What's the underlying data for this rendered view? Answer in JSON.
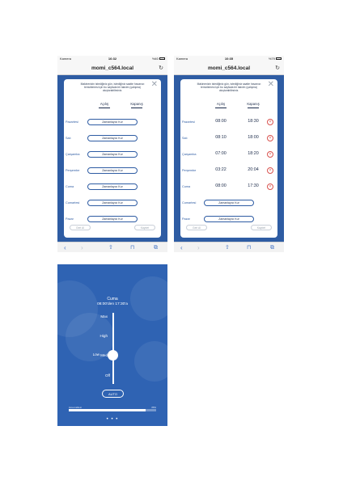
{
  "phones": [
    {
      "status": {
        "left": "Kamera",
        "time": "16:32",
        "right": "%40"
      },
      "url": "momi_c564.local",
      "instruction": "Makinenizin istediğiniz gün, istediğiniz saatte havanızı temizlemesi için bu sayfada bir takvim (çalışma) oluşturabilirsiniz.",
      "col_open": "Açılış",
      "col_close": "Kapanış",
      "days": [
        {
          "label": "Pazartesi",
          "button": "Zamanlayıcı Kur"
        },
        {
          "label": "Salı",
          "button": "Zamanlayıcı Kur"
        },
        {
          "label": "Çarşamba",
          "button": "Zamanlayıcı Kur"
        },
        {
          "label": "Perşembe",
          "button": "Zamanlayıcı Kur"
        },
        {
          "label": "Cuma",
          "button": "Zamanlayıcı Kur"
        },
        {
          "label": "Cumartesi",
          "button": "Zamanlayıcı Kur"
        },
        {
          "label": "Pazar",
          "button": "Zamanlayıcı Kur"
        }
      ],
      "footer_left": "Geri Al",
      "footer_right": "Kaydet"
    },
    {
      "status": {
        "left": "Kamera",
        "time": "10:35",
        "right": "%79"
      },
      "url": "momi_c564.local",
      "instruction": "Makinenizin istediğiniz gün, istediğiniz saatte havanızı temizlemesi için bu sayfada bir takvim (çalışma) oluşturabilirsiniz.",
      "col_open": "Açılış",
      "col_close": "Kapanış",
      "days": [
        {
          "label": "Pazartesi",
          "open": "08:00",
          "close": "18:30"
        },
        {
          "label": "Salı",
          "open": "08:10",
          "close": "18:00"
        },
        {
          "label": "Çarşamba",
          "open": "07:00",
          "close": "18:20"
        },
        {
          "label": "Perşembe",
          "open": "03:22",
          "close": "20:04"
        },
        {
          "label": "Cuma",
          "open": "08:00",
          "close": "17:30"
        },
        {
          "label": "Cumartesi",
          "button": "Zamanlayıcı Kur"
        },
        {
          "label": "Pazar",
          "button": "Zamanlayıcı Kur"
        }
      ],
      "delete_glyph": "×",
      "footer_left": "Geri Al",
      "footer_right": "Kaydet"
    }
  ],
  "app": {
    "title": "Cuma",
    "subtitle": "08:00'den 17:30'a",
    "levels": [
      "Max",
      "High",
      "Med",
      "Low",
      "Off"
    ],
    "selected_level": "Low",
    "auto_label": "AUTO",
    "progress_left": "Hava kalitesi",
    "progress_right": "88%",
    "progress_value": 0.88,
    "dots": "• • •"
  },
  "icons": {
    "reload": "↻",
    "close": "✕",
    "back": "‹",
    "forward": "›",
    "share": "⇧",
    "bookmarks": "⊓",
    "tabs": "⧉"
  },
  "colors": {
    "accent": "#2e5ca3",
    "app_bg": "#2f63b3",
    "danger": "#d9534f"
  }
}
